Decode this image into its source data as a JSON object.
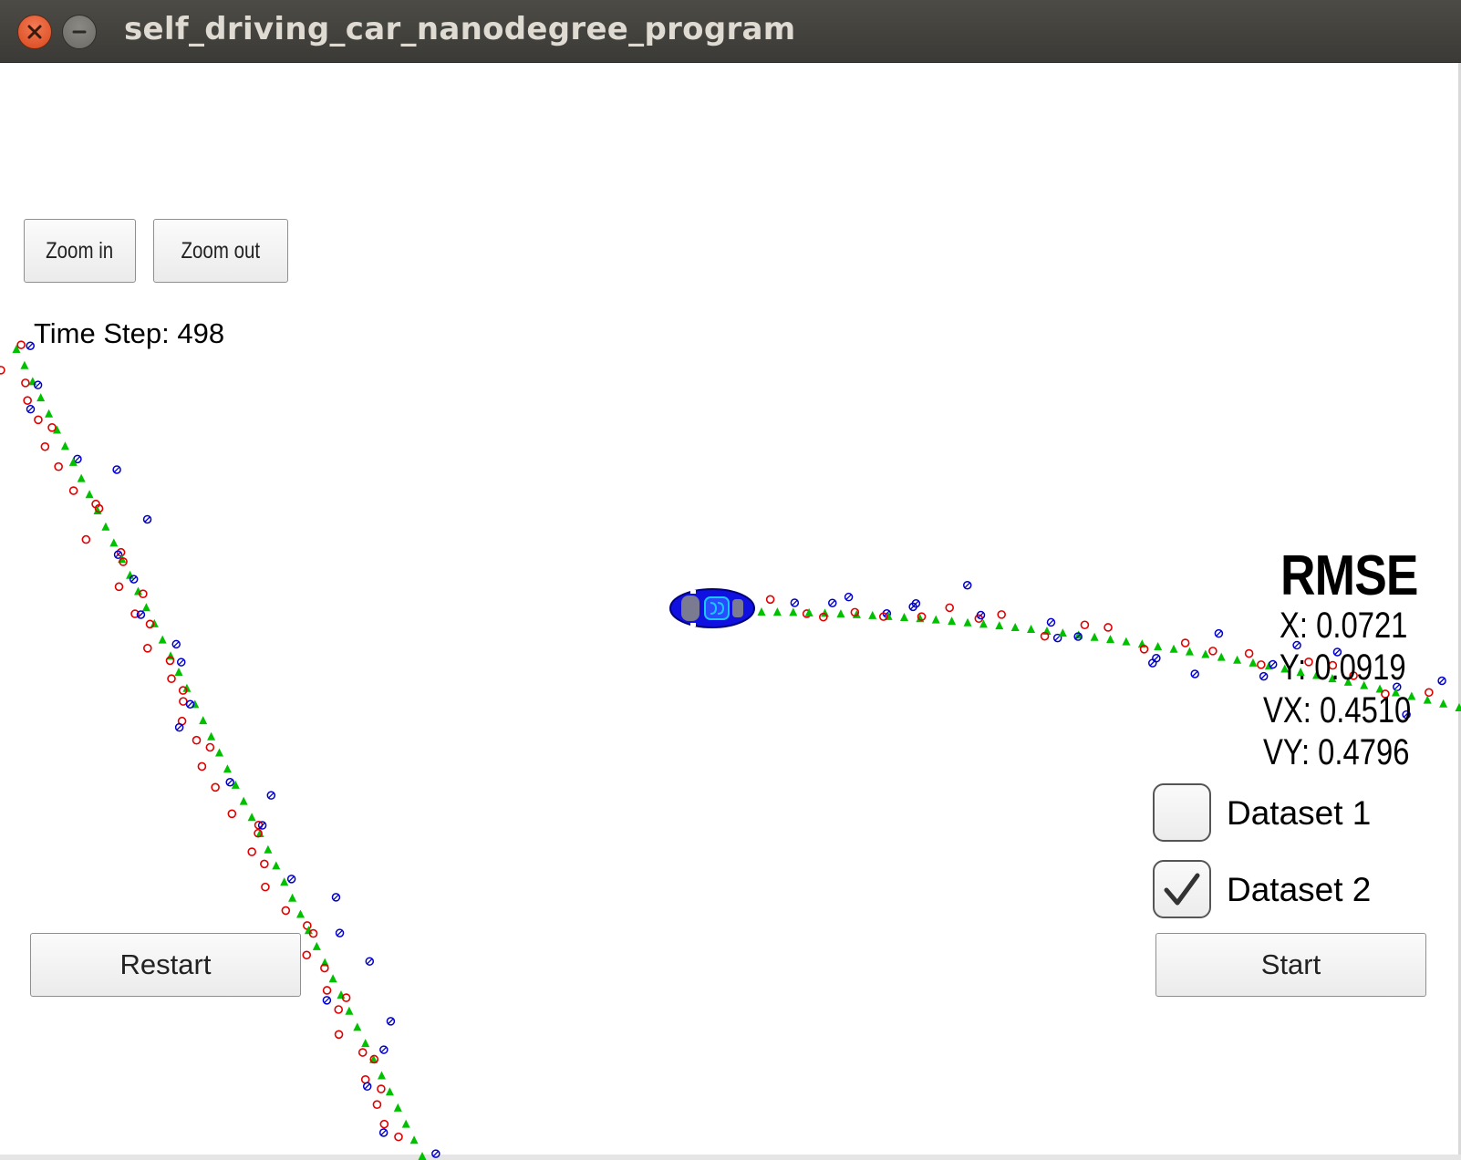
{
  "window": {
    "title": "self_driving_car_nanodegree_program"
  },
  "toolbar": {
    "zoom_in_label": "Zoom in",
    "zoom_out_label": "Zoom out"
  },
  "status": {
    "time_step": "Time Step: 498"
  },
  "rmse": {
    "title": "RMSE",
    "x": "X: 0.0721",
    "y": "Y: 0.0919",
    "vx": "VX: 0.4510",
    "vy": "VY: 0.4796"
  },
  "datasets": [
    {
      "label": "Dataset 1",
      "checked": false
    },
    {
      "label": "Dataset 2",
      "checked": true
    }
  ],
  "controls": {
    "restart_label": "Restart",
    "start_label": "Start"
  },
  "markers": {
    "lidar": {
      "color": "#e00000",
      "shape": "hollow-circle"
    },
    "radar": {
      "color": "#0000c8",
      "shape": "circle-with-arrow"
    },
    "estimate": {
      "color": "#00c000",
      "shape": "triangle"
    }
  }
}
